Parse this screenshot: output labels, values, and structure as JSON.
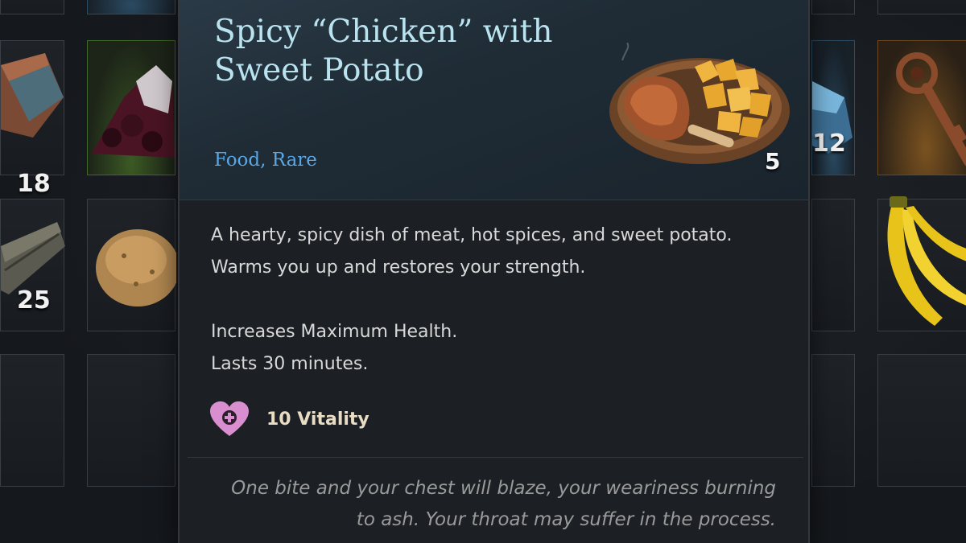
{
  "item": {
    "name": "Spicy “Chicken” with Sweet Potato",
    "category": "Food, Rare",
    "count": "5",
    "icon": "roast-chicken-with-potatoes-plate-icon",
    "description": "A hearty, spicy dish of meat, hot spices, and sweet potato. Warms you up and restores your strength.",
    "effects": [
      "Increases Maximum Health.",
      "Lasts 30 minutes."
    ],
    "stat": {
      "icon": "heart-plus-icon",
      "label": "10 Vitality",
      "color": "#d98fcf"
    },
    "flavor_text": "One bite and your chest will blaze, your weariness burning to ash. Your throat may suffer in the process."
  },
  "inventory": {
    "left_slots": [
      {
        "icon": "rusty-metal-ingot-icon",
        "count": "18"
      },
      {
        "icon": "dark-berry-pile-icon",
        "count": ""
      },
      {
        "icon": "wood-log-icon",
        "count": "25"
      },
      {
        "icon": "potato-icon",
        "count": ""
      }
    ],
    "right_slots": [
      {
        "icon": "blue-crystal-icon",
        "count": "12"
      },
      {
        "icon": "ornate-key-icon",
        "count": ""
      },
      {
        "icon": "empty-slot",
        "count": ""
      },
      {
        "icon": "banana-bunch-icon",
        "count": ""
      }
    ]
  },
  "colors": {
    "title": "#b9e3ef",
    "category": "#5aa7e6",
    "panel_bg": "#1c1f24",
    "stat_label": "#e8dcc4"
  }
}
